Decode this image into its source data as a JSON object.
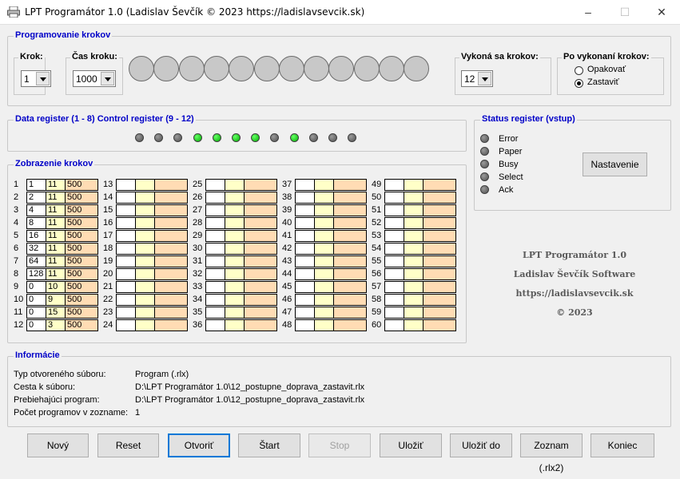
{
  "window": {
    "title": "LPT Programátor 1.0 (Ladislav Ševčík © 2023 https://ladislavsevcik.sk)",
    "minimize": "–",
    "maximize": "☐",
    "close": "✕"
  },
  "programming": {
    "title": "Programovanie krokov",
    "krok_label": "Krok:",
    "krok_value": "1",
    "cas_label": "Čas kroku:",
    "cas_value": "1000",
    "vykona_label": "Vykoná sa krokov:",
    "vykona_value": "12",
    "po_label": "Po vykonaní krokov:",
    "opt_repeat": "Opakovať",
    "opt_stop": "Zastaviť",
    "selected_option": "Zastaviť",
    "bit_leds": [
      0,
      0,
      0,
      0,
      0,
      0,
      0,
      0,
      0,
      0,
      0,
      0
    ]
  },
  "registers": {
    "title": "Data register (1 - 8) Control register (9 - 12)",
    "leds": [
      0,
      0,
      0,
      1,
      1,
      1,
      1,
      0,
      1,
      0,
      0,
      0
    ]
  },
  "status": {
    "title": "Status register (vstup)",
    "items": [
      "Error",
      "Paper",
      "Busy",
      "Select",
      "Ack"
    ],
    "button": "Nastavenie"
  },
  "steps": {
    "title": "Zobrazenie krokov",
    "rows": [
      [
        "1",
        "11",
        "500"
      ],
      [
        "2",
        "11",
        "500"
      ],
      [
        "4",
        "11",
        "500"
      ],
      [
        "8",
        "11",
        "500"
      ],
      [
        "16",
        "11",
        "500"
      ],
      [
        "32",
        "11",
        "500"
      ],
      [
        "64",
        "11",
        "500"
      ],
      [
        "128",
        "11",
        "500"
      ],
      [
        "0",
        "10",
        "500"
      ],
      [
        "0",
        "9",
        "500"
      ],
      [
        "0",
        "15",
        "500"
      ],
      [
        "0",
        "3",
        "500"
      ]
    ],
    "numbers": [
      "1",
      "2",
      "3",
      "4",
      "5",
      "6",
      "7",
      "8",
      "9",
      "10",
      "11",
      "12",
      "13",
      "14",
      "15",
      "16",
      "17",
      "18",
      "19",
      "20",
      "21",
      "22",
      "23",
      "24",
      "25",
      "26",
      "27",
      "28",
      "29",
      "30",
      "31",
      "32",
      "33",
      "34",
      "35",
      "36",
      "37",
      "38",
      "39",
      "40",
      "41",
      "42",
      "43",
      "44",
      "45",
      "46",
      "47",
      "48",
      "49",
      "50",
      "51",
      "52",
      "53",
      "54",
      "55",
      "56",
      "57",
      "58",
      "59",
      "60"
    ]
  },
  "brand": {
    "line1": "LPT Programátor 1.0",
    "line2": "Ladislav Ševčík Software",
    "line3": "https://ladislavsevcik.sk",
    "line4": "© 2023"
  },
  "info": {
    "title": "Informácie",
    "labels": [
      "Typ otvoreného súboru:",
      "Cesta k súboru:",
      "Prebiehajúci program:",
      "Počet programov v zozname:"
    ],
    "values": [
      "Program (.rlx)",
      "D:\\LPT Programátor 1.0\\12_postupne_doprava_zastavit.rlx",
      "D:\\LPT Programátor 1.0\\12_postupne_doprava_zastavit.rlx",
      "1"
    ]
  },
  "buttons": {
    "new": "Nový",
    "reset": "Reset",
    "open": "Otvoriť",
    "start": "Štart",
    "stop": "Stop",
    "save": "Uložiť",
    "save_to": "Uložiť do",
    "list": "Zoznam (.rlx2)",
    "end": "Koniec"
  }
}
